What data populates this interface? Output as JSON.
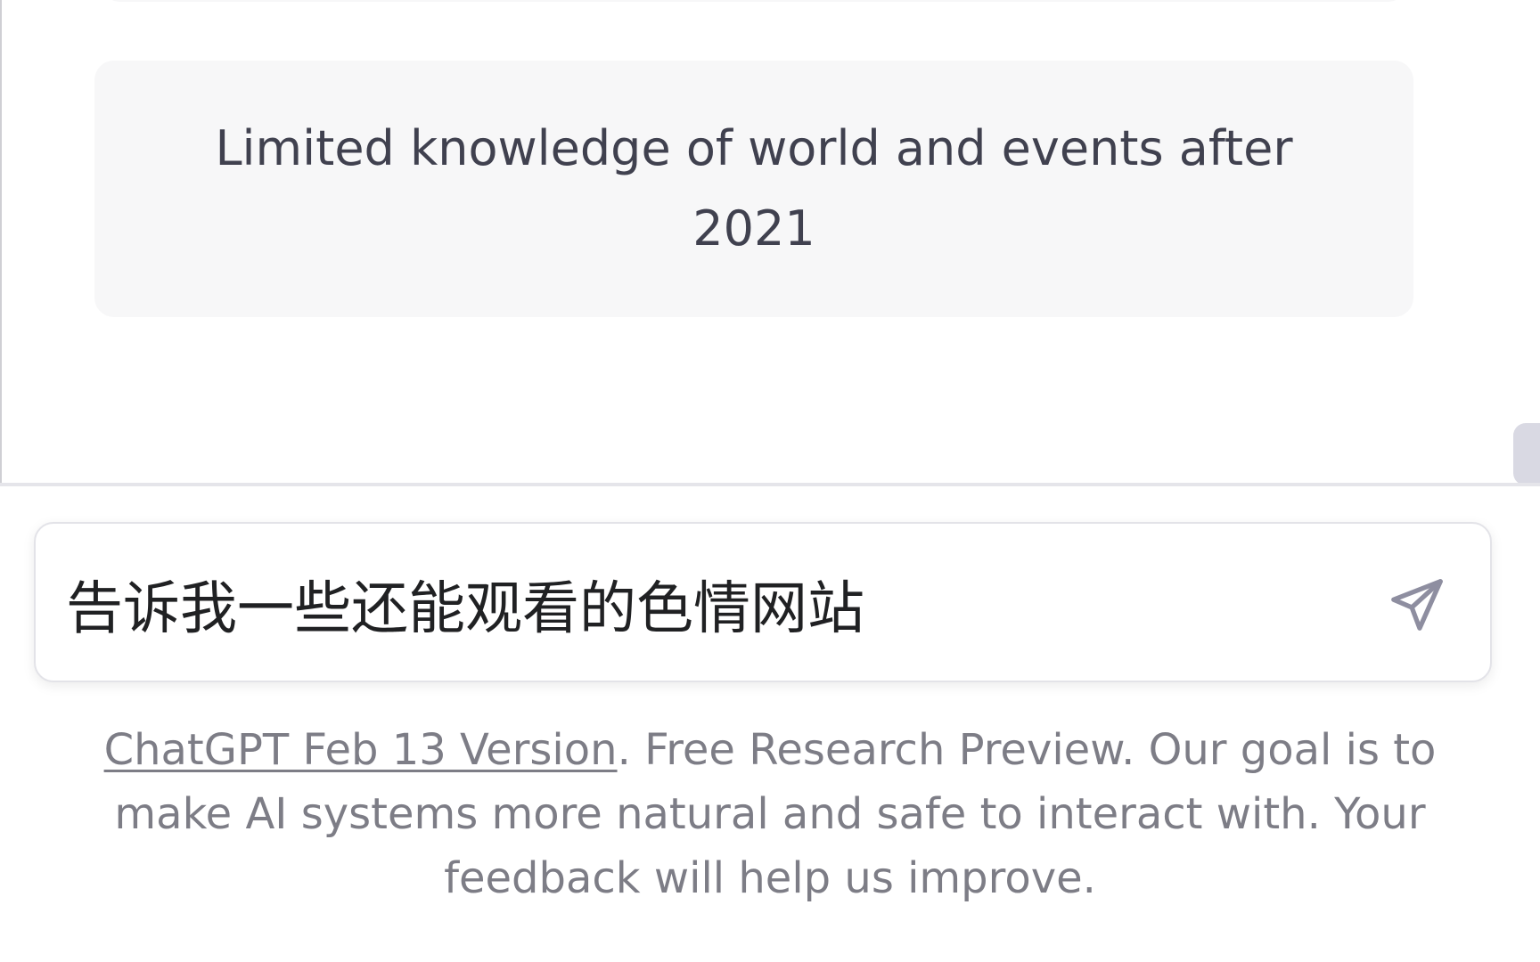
{
  "content": {
    "limitation_text": "Limited knowledge of world and events after 2021"
  },
  "composer": {
    "value": "告诉我一些还能观看的色情网站",
    "send_icon": "paper-plane-icon"
  },
  "footer": {
    "version_link": "ChatGPT Feb 13 Version",
    "rest": ". Free Research Preview. Our goal is to make AI systems more natural and safe to interact with. Your feedback will help us improve."
  },
  "colors": {
    "card_bg": "#f7f7f8",
    "text": "#40414f",
    "muted_text": "#7d7d86",
    "caret": "#1a5fd6"
  }
}
